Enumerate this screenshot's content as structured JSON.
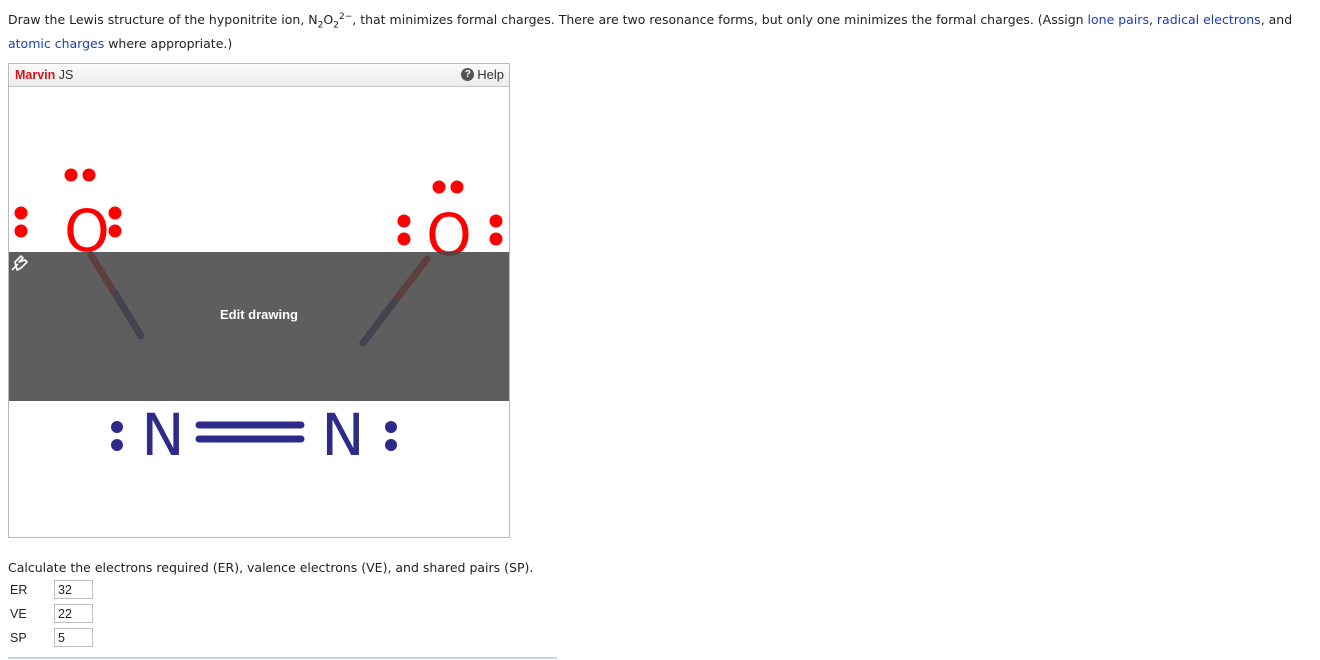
{
  "question": {
    "part1": "Draw the Lewis structure of the hyponitrite ion, N",
    "sub1": "2",
    "mid1": "O",
    "sub2": "2",
    "sup": "2−",
    "part2": ", that minimizes formal charges. There are two resonance forms, but only one minimizes the formal charges. (Assign ",
    "link1": "lone pairs",
    "sep1": ", ",
    "link2": "radical electrons",
    "sep2": ", and ",
    "link3": "atomic charges",
    "part3": " where appropriate.)"
  },
  "marvin": {
    "brand": "Marvin",
    "suffix": " JS",
    "help_label": "Help",
    "edit_label": "Edit drawing",
    "atoms": {
      "o_left": "O",
      "o_right": "O",
      "n_left": "N",
      "n_right": "N"
    },
    "colors": {
      "oxygen": "#ff0000",
      "nitrogen": "#2d2a8a",
      "brand": "#d8111b"
    }
  },
  "calc": {
    "prompt": "Calculate the electrons required (ER), valence electrons (VE), and shared pairs (SP).",
    "rows": [
      {
        "label": "ER",
        "value": "32"
      },
      {
        "label": "VE",
        "value": "22"
      },
      {
        "label": "SP",
        "value": "5"
      }
    ]
  }
}
